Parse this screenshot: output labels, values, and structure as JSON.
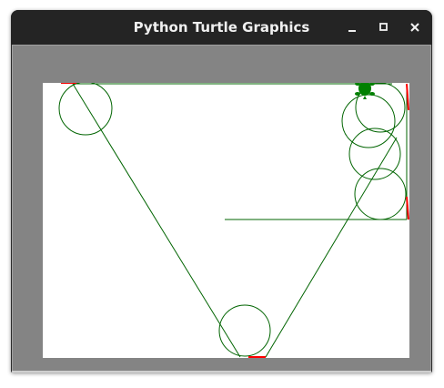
{
  "window": {
    "title": "Python Turtle Graphics"
  },
  "controls": {
    "minimize_icon": "minimize-icon",
    "maximize_icon": "maximize-icon",
    "close_icon": "close-icon"
  },
  "colors": {
    "titlebar": "#242424",
    "frame": "#848484",
    "canvas": "#ffffff",
    "pen": "#006400",
    "accent_marks": "#ff0000",
    "turtle": "#008000"
  },
  "canvas": {
    "turtle_shape": "turtle"
  }
}
